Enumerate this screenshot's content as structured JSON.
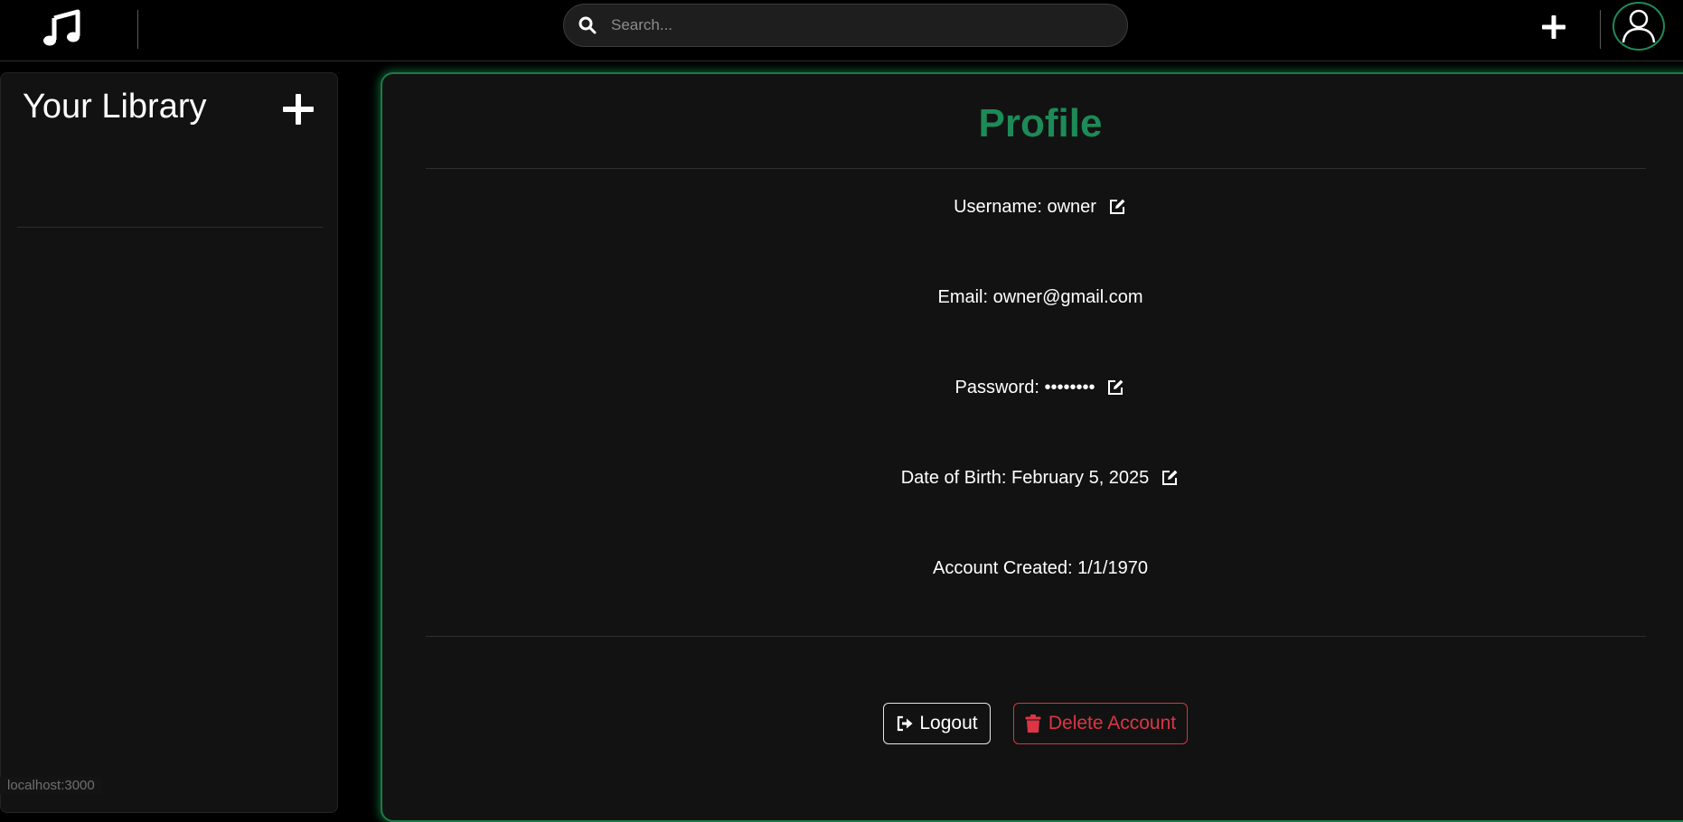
{
  "topbar": {
    "logo_icon": "music-note-icon",
    "search_placeholder": "Search...",
    "search_icon": "search-icon",
    "add_icon": "plus-icon",
    "avatar_icon": "user-avatar-icon"
  },
  "sidebar": {
    "title": "Your Library",
    "add_icon": "plus-icon"
  },
  "profile": {
    "title": "Profile",
    "username": "Username: owner",
    "email": "Email: owner@gmail.com",
    "password": "Password: ••••••••",
    "dob": "Date of Birth: February 5, 2025",
    "created": "Account Created: 1/1/1970",
    "edit_icon": "edit-icon"
  },
  "actions": {
    "logout_label": "Logout",
    "logout_icon": "sign-out-icon",
    "delete_label": "Delete Account",
    "delete_icon": "trash-icon"
  },
  "status": {
    "url": "localhost:3000"
  },
  "colors": {
    "accent_green": "#1d8a57",
    "danger_red": "#dc3545",
    "panel_bg": "#121212"
  }
}
